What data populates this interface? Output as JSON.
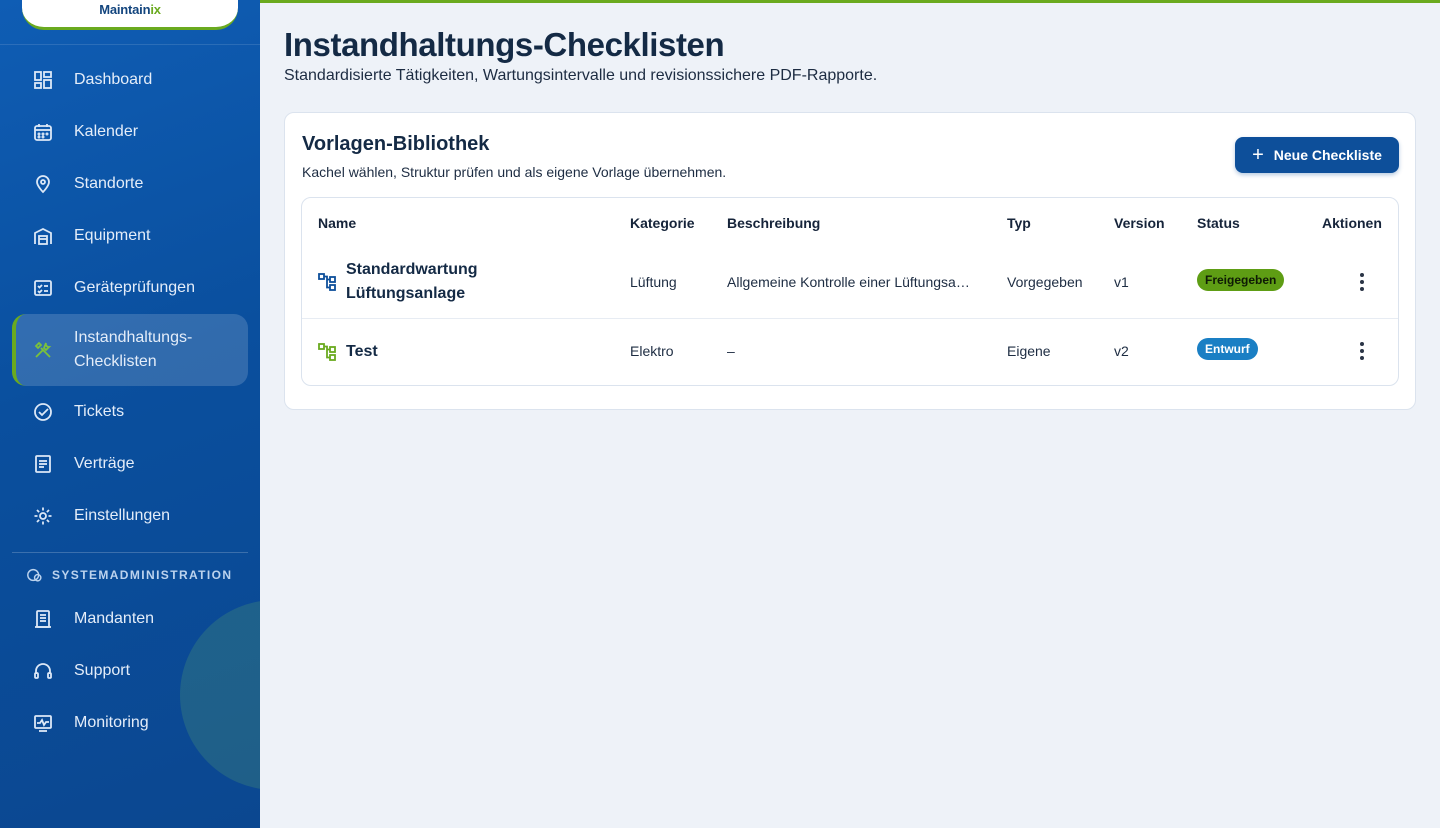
{
  "app": {
    "logo_main": "Maintain",
    "logo_accent": "ix"
  },
  "sidebar": {
    "items": [
      {
        "label": "Dashboard",
        "icon": "dashboard-icon"
      },
      {
        "label": "Kalender",
        "icon": "calendar-icon"
      },
      {
        "label": "Standorte",
        "icon": "location-pin-icon"
      },
      {
        "label": "Equipment",
        "icon": "warehouse-icon"
      },
      {
        "label": "Geräteprüfungen",
        "icon": "checklist-icon"
      },
      {
        "label": "Instandhaltungs-",
        "label2": "Checklisten",
        "icon": "tools-icon",
        "active": true
      },
      {
        "label": "Tickets",
        "icon": "check-circle-icon"
      },
      {
        "label": "Verträge",
        "icon": "document-icon"
      },
      {
        "label": "Einstellungen",
        "icon": "gear-icon"
      }
    ],
    "section_title": "SYSTEMADMINISTRATION",
    "admin_items": [
      {
        "label": "Mandanten",
        "icon": "tenants-icon"
      },
      {
        "label": "Support",
        "icon": "headset-icon"
      },
      {
        "label": "Monitoring",
        "icon": "monitoring-icon"
      }
    ]
  },
  "header": {
    "title": "Instandhaltungs-Checklisten",
    "subtitle": "Standardisierte Tätigkeiten, Wartungsintervalle und revisionssichere PDF-Rapporte."
  },
  "library": {
    "title": "Vorlagen-Bibliothek",
    "subtitle": "Kachel wählen, Struktur prüfen und als eigene Vorlage übernehmen.",
    "new_button": "Neue Checkliste",
    "columns": [
      "Name",
      "Kategorie",
      "Beschreibung",
      "Typ",
      "Version",
      "Status",
      "Aktionen"
    ],
    "rows": [
      {
        "name_line1": "Standardwartung",
        "name_line2": "Lüftungsanlage",
        "category": "Lüftung",
        "description": "Allgemeine Kontrolle einer Lüftungsa…",
        "type": "Vorgegeben",
        "version": "v1",
        "status": "Freigegeben",
        "status_color": "#5e9d14",
        "icon_color": "#0d4f9a"
      },
      {
        "name_line1": "Test",
        "category": "Elektro",
        "description": "–",
        "type": "Eigene",
        "version": "v2",
        "status": "Entwurf",
        "status_color": "#1a7fc4",
        "icon_color": "#6aaa1f"
      }
    ]
  },
  "colors": {
    "brand_blue": "#0d4f9a",
    "brand_green": "#6aaa1f",
    "background": "#eef2f8"
  }
}
